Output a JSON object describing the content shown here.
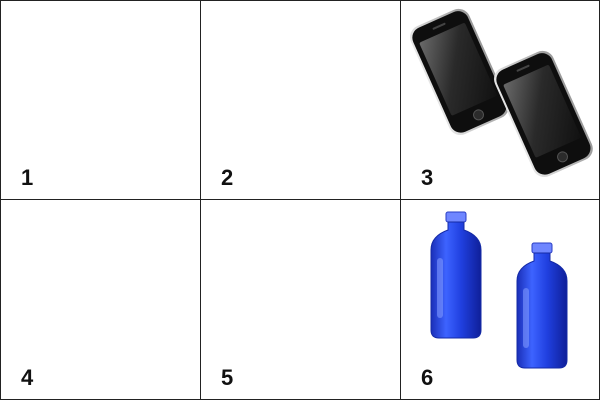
{
  "grid": {
    "cells": [
      {
        "label": "1",
        "content": "empty"
      },
      {
        "label": "2",
        "content": "empty"
      },
      {
        "label": "3",
        "content": "smartphone-icon"
      },
      {
        "label": "4",
        "content": "empty"
      },
      {
        "label": "5",
        "content": "empty"
      },
      {
        "label": "6",
        "content": "blue-bottle-icon"
      }
    ]
  },
  "colors": {
    "border": "#222222",
    "bottle_blue": "#1f3fd6",
    "phone_body": "#1a1a1a"
  }
}
